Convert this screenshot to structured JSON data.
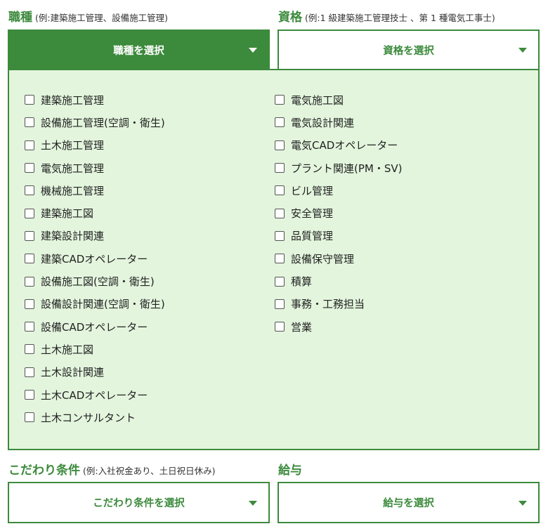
{
  "job_type": {
    "title": "職種",
    "example": "(例:建築施工管理、設備施工管理)",
    "select_label": "職種を選択",
    "options_left": [
      "建築施工管理",
      "設備施工管理(空調・衛生)",
      "土木施工管理",
      "電気施工管理",
      "機械施工管理",
      "建築施工図",
      "建築設計関連",
      "建築CADオペレーター",
      "設備施工図(空調・衛生)",
      "設備設計関連(空調・衛生)",
      "設備CADオペレーター",
      "土木施工図",
      "土木設計関連",
      "土木CADオペレーター",
      "土木コンサルタント"
    ],
    "options_right": [
      "電気施工図",
      "電気設計関連",
      "電気CADオペレーター",
      "プラント関連(PM・SV)",
      "ビル管理",
      "安全管理",
      "品質管理",
      "設備保守管理",
      "積算",
      "事務・工務担当",
      "営業"
    ]
  },
  "qualification": {
    "title": "資格",
    "example": "(例:1 級建築施工管理技士 、第 1 種電気工事士)",
    "select_label": "資格を選択"
  },
  "preference": {
    "title": "こだわり条件",
    "example": "(例:入社祝金あり、土日祝日休み)",
    "select_label": "こだわり条件を選択"
  },
  "salary": {
    "title": "給与",
    "select_label": "給与を選択"
  },
  "colors": {
    "accent": "#3c8a3c",
    "panel_bg": "#e3f5dd"
  }
}
